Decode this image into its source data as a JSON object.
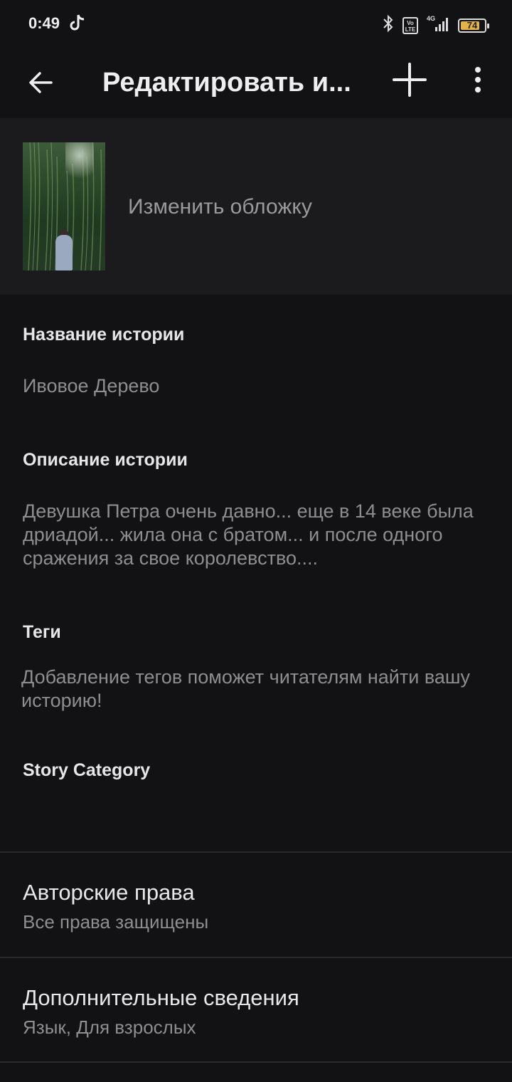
{
  "status": {
    "time": "0:49",
    "volte": "Vo LTE",
    "network": "4G",
    "battery": "74"
  },
  "appbar": {
    "title": "Редактировать и...",
    "back_icon": "arrow-back-icon",
    "add_icon": "plus-icon",
    "more_icon": "more-vert-icon"
  },
  "cover": {
    "change_label": "Изменить обложку"
  },
  "fields": {
    "title_label": "Название истории",
    "title_value": "Ивовое Дерево",
    "description_label": "Описание истории",
    "description_value": "Девушка Петра очень давно... еще в 14 веке была дриадой... жила она с братом... и после одного сражения за свое королевство....",
    "tags_label": "Теги",
    "tags_placeholder": "Добавление тегов поможет читателям найти вашу историю!",
    "category_label": "Story Category"
  },
  "rows": {
    "copyright_title": "Авторские права",
    "copyright_sub": "Все права защищены",
    "details_title": "Дополнительные сведения",
    "details_sub": "Язык, Для взрослых"
  }
}
